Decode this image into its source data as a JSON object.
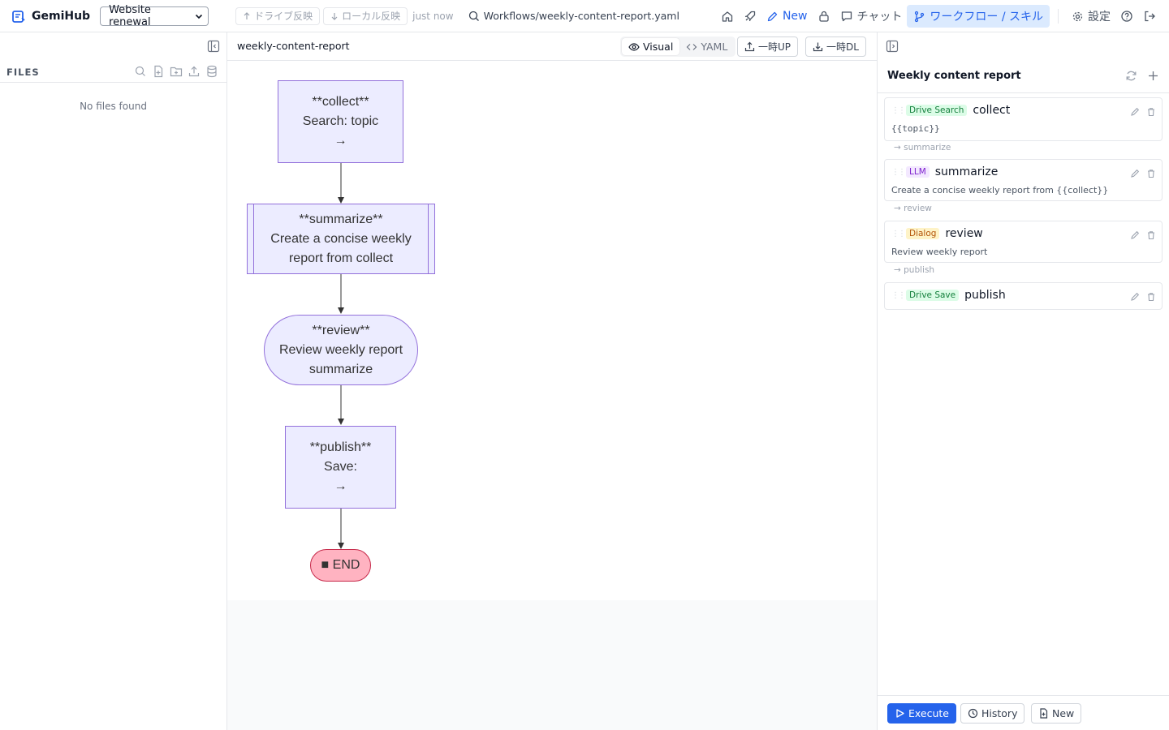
{
  "app": {
    "name": "GemiHub",
    "project": "Website renewal"
  },
  "sync": {
    "drive_label": "ドライブ反映",
    "local_label": "ローカル反映",
    "status": "just now"
  },
  "current_path": "Workflows/weekly-content-report.yaml",
  "nav": {
    "new_label": "New",
    "chat_label": "チャット",
    "workflow_label": "ワークフロー / スキル",
    "settings_label": "設定"
  },
  "sidebar": {
    "title": "FILES",
    "empty_text": "No files found"
  },
  "editor": {
    "workflow_name": "weekly-content-report",
    "visual_label": "Visual",
    "yaml_label": "YAML",
    "upload_label": "一時UP",
    "download_label": "一時DL"
  },
  "diagram": {
    "nodes": [
      {
        "lines": [
          "**collect**",
          "Search: topic",
          "→"
        ]
      },
      {
        "lines": [
          "**summarize**",
          "Create a concise weekly",
          "report from collect"
        ]
      },
      {
        "lines": [
          "**review**",
          "Review weekly report",
          "summarize"
        ]
      },
      {
        "lines": [
          "**publish**",
          "Save:",
          "→"
        ]
      },
      {
        "lines": [
          "■ END"
        ]
      }
    ]
  },
  "panel": {
    "title": "Weekly content report",
    "nodes": [
      {
        "type": "Drive Search",
        "name": "collect",
        "desc": "{{topic}}",
        "next": "→ summarize"
      },
      {
        "type": "LLM",
        "name": "summarize",
        "desc": "Create a concise weekly report from {{collect}}",
        "next": "→ review"
      },
      {
        "type": "Dialog",
        "name": "review",
        "desc": "Review weekly report",
        "next": "→ publish"
      },
      {
        "type": "Drive Save",
        "name": "publish"
      }
    ],
    "footer": {
      "execute_label": "Execute",
      "history_label": "History",
      "new_label": "New"
    }
  },
  "colors": {
    "accent": "#2563eb",
    "node_fill": "#ececff",
    "node_stroke": "#9370db",
    "end_fill": "#ffb3c1",
    "end_stroke": "#c62849"
  }
}
